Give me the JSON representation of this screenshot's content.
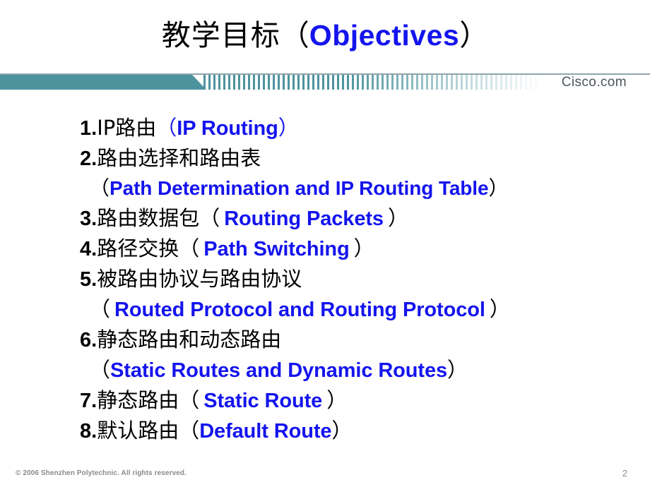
{
  "slide": {
    "title": {
      "cn": "教学目标",
      "open_paren": "（",
      "en": "Objectives",
      "close_paren": "）"
    },
    "banner": {
      "brand": "Cisco.com",
      "teal": "#4d939e",
      "brand_color": "#4c545c"
    },
    "accent_blue": "#1414ee",
    "bullets": [
      {
        "num": "1.",
        "cn": "IP路由",
        "open_paren": "（",
        "en": "IP Routing",
        "close_paren": "）",
        "paren_blue": true,
        "wrap": false
      },
      {
        "num": "2.",
        "cn": "路由选择和路由表",
        "open_paren": "（",
        "en": "Path Determination and IP Routing Table",
        "close_paren": "）",
        "paren_blue": false,
        "wrap": true
      },
      {
        "num": "3.",
        "cn": "路由数据包",
        "open_paren": "（",
        "en": "Routing Packets",
        "close_paren": "）",
        "paren_blue": false,
        "wrap": false,
        "spaced": true
      },
      {
        "num": "4.",
        "cn": "路径交换",
        "open_paren": "（",
        "en": "Path Switching",
        "close_paren": "）",
        "paren_blue": false,
        "wrap": false,
        "spaced": true
      },
      {
        "num": "5.",
        "cn": "被路由协议与路由协议",
        "open_paren": "（",
        "en": "Routed Protocol and Routing Protocol",
        "close_paren": "）",
        "paren_blue": false,
        "wrap": true,
        "spaced": true
      },
      {
        "num": "6.",
        "cn": "静态路由和动态路由",
        "open_paren": "（",
        "en": "Static Routes and Dynamic Routes",
        "close_paren": "）",
        "paren_blue": false,
        "wrap": true
      },
      {
        "num": "7.",
        "cn": "静态路由",
        "open_paren": "（",
        "en": "Static Route",
        "close_paren": "）",
        "paren_blue": false,
        "wrap": false,
        "spaced": true
      },
      {
        "num": "8.",
        "cn": "默认路由",
        "open_paren": "（",
        "en": "Default Route",
        "close_paren": "）",
        "paren_blue": false,
        "wrap": false
      }
    ],
    "footer": {
      "copyright": "© 2006 Shenzhen Polytechnic. All rights reserved.",
      "page_number": "2"
    }
  }
}
